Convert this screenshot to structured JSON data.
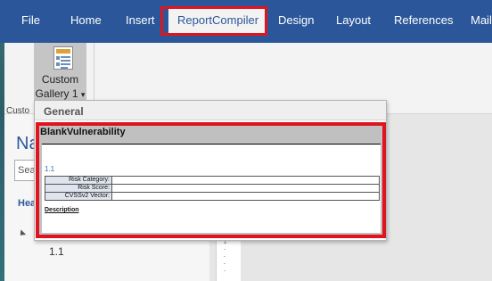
{
  "ribbon_tabs": [
    {
      "label": "File"
    },
    {
      "label": "Home"
    },
    {
      "label": "Insert"
    },
    {
      "label": "ReportCompiler",
      "active": true,
      "highlighted": true
    },
    {
      "label": "Design"
    },
    {
      "label": "Layout"
    },
    {
      "label": "References"
    },
    {
      "label": "Mail"
    }
  ],
  "ribbon": {
    "gallery_button": {
      "label_line1": "Custom",
      "label_line2": "Gallery 1",
      "dropdown_glyph": "▾",
      "icon": "document-template-icon"
    },
    "group_label": "Custo"
  },
  "navigation": {
    "title": "Na",
    "search_value": "Sea",
    "heading_label": "Hea",
    "expand_icon": "triangle-expand-icon",
    "item_label": "1.1"
  },
  "page_marks": [
    "1",
    "-",
    "-",
    "-",
    "-"
  ],
  "gallery_dropdown": {
    "section_header": "General",
    "entry": {
      "title": "BlankVulnerability",
      "preview": {
        "heading": "1.1",
        "fields": [
          {
            "label": "Risk Category:"
          },
          {
            "label": "Risk Score:"
          },
          {
            "label": "CVSSv2 Vector:"
          }
        ],
        "description_label": "Description"
      }
    }
  },
  "colors": {
    "ribbon_blue": "#2b579a",
    "highlight_red": "#e0141e",
    "entry_bg": "#c0c0c0"
  }
}
